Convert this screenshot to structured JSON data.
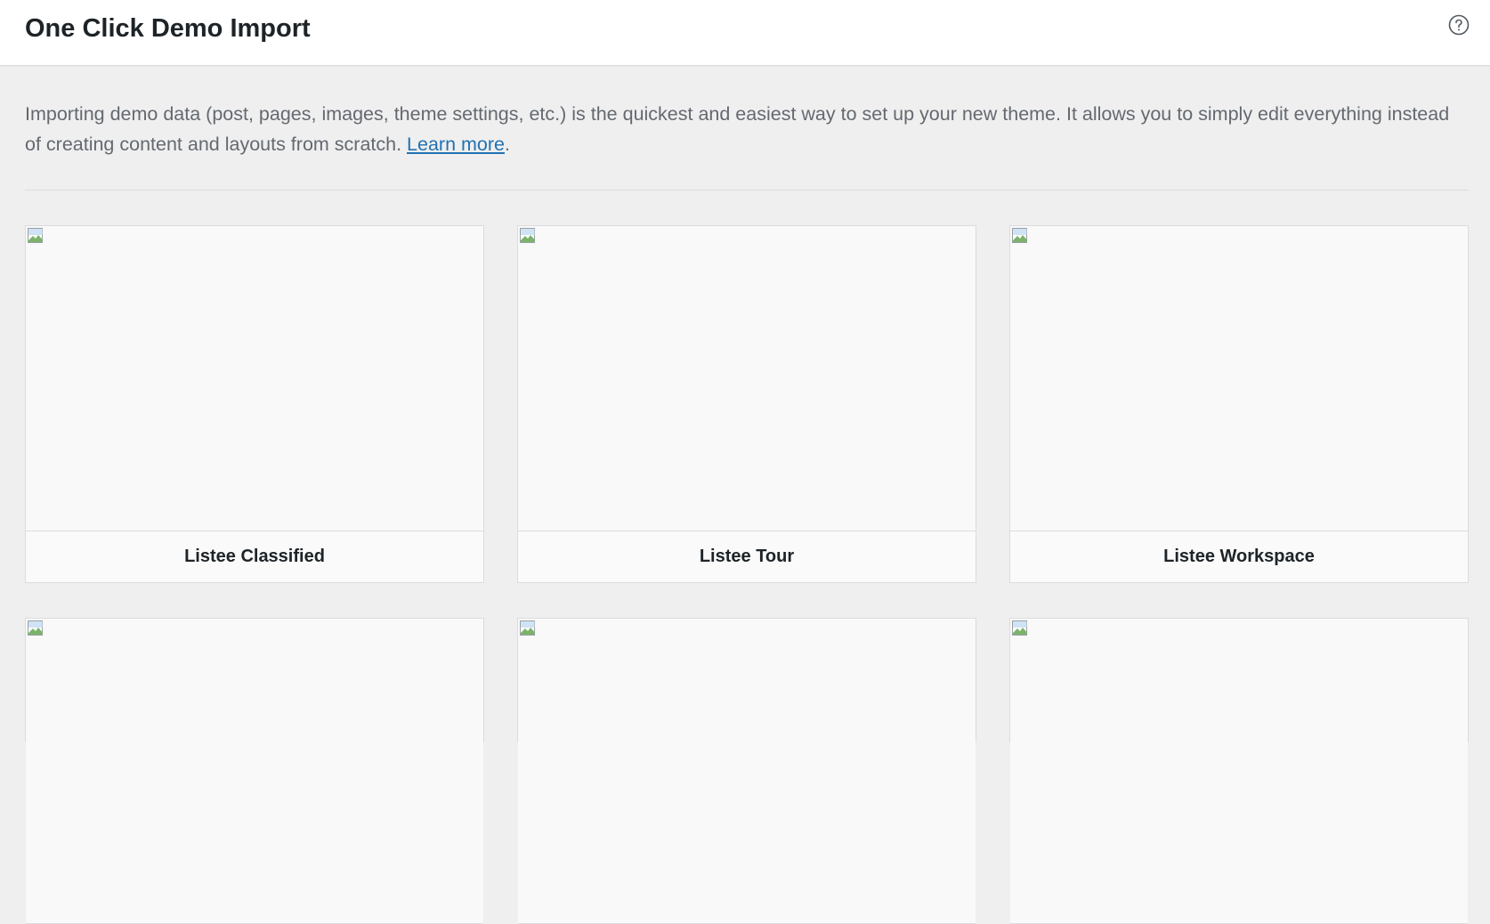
{
  "header": {
    "title": "One Click Demo Import",
    "help_icon": "question-circle-icon"
  },
  "intro": {
    "text": "Importing demo data (post, pages, images, theme settings, etc.) is the quickest and easiest way to set up your new theme. It allows you to simply edit everything instead of creating content and layouts from scratch. ",
    "link_label": "Learn more",
    "trailing": "."
  },
  "demos": [
    {
      "name": "Listee Classified"
    },
    {
      "name": "Listee Tour"
    },
    {
      "name": "Listee Workspace"
    },
    {
      "name": ""
    },
    {
      "name": ""
    },
    {
      "name": ""
    }
  ],
  "colors": {
    "link": "#2271b1",
    "background": "#efefef",
    "header_background": "#ffffff"
  }
}
